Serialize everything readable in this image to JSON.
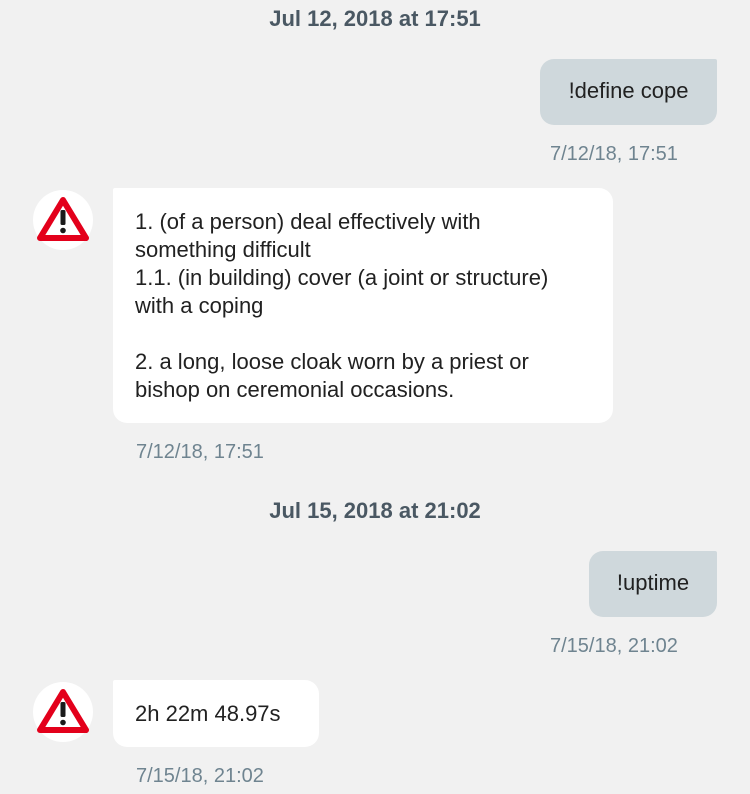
{
  "thread": {
    "messages": [
      {
        "date_header": "Jul 12, 2018 at 17:51",
        "outgoing": {
          "text": "!define cope",
          "timestamp": "7/12/18, 17:51"
        },
        "incoming": {
          "lines": [
            "1. (of a person) deal effectively with",
            "something difficult",
            "1.1. (in building) cover (a joint or structure)",
            "with a coping",
            "",
            "2. a long, loose cloak worn by a priest or",
            "bishop on ceremonial occasions."
          ],
          "timestamp": "7/12/18, 17:51"
        }
      },
      {
        "date_header": "Jul 15, 2018 at 21:02",
        "outgoing": {
          "text": "!uptime",
          "timestamp": "7/15/18, 21:02"
        },
        "incoming": {
          "lines": [
            "2h 22m 48.97s"
          ],
          "timestamp": "7/15/18, 21:02"
        }
      }
    ]
  },
  "avatar_icon": "warning-triangle-icon",
  "colors": {
    "background": "#f1f1f1",
    "outgoing_bubble": "#cfd8dc",
    "incoming_bubble": "#ffffff",
    "warning_red": "#e3001b"
  }
}
